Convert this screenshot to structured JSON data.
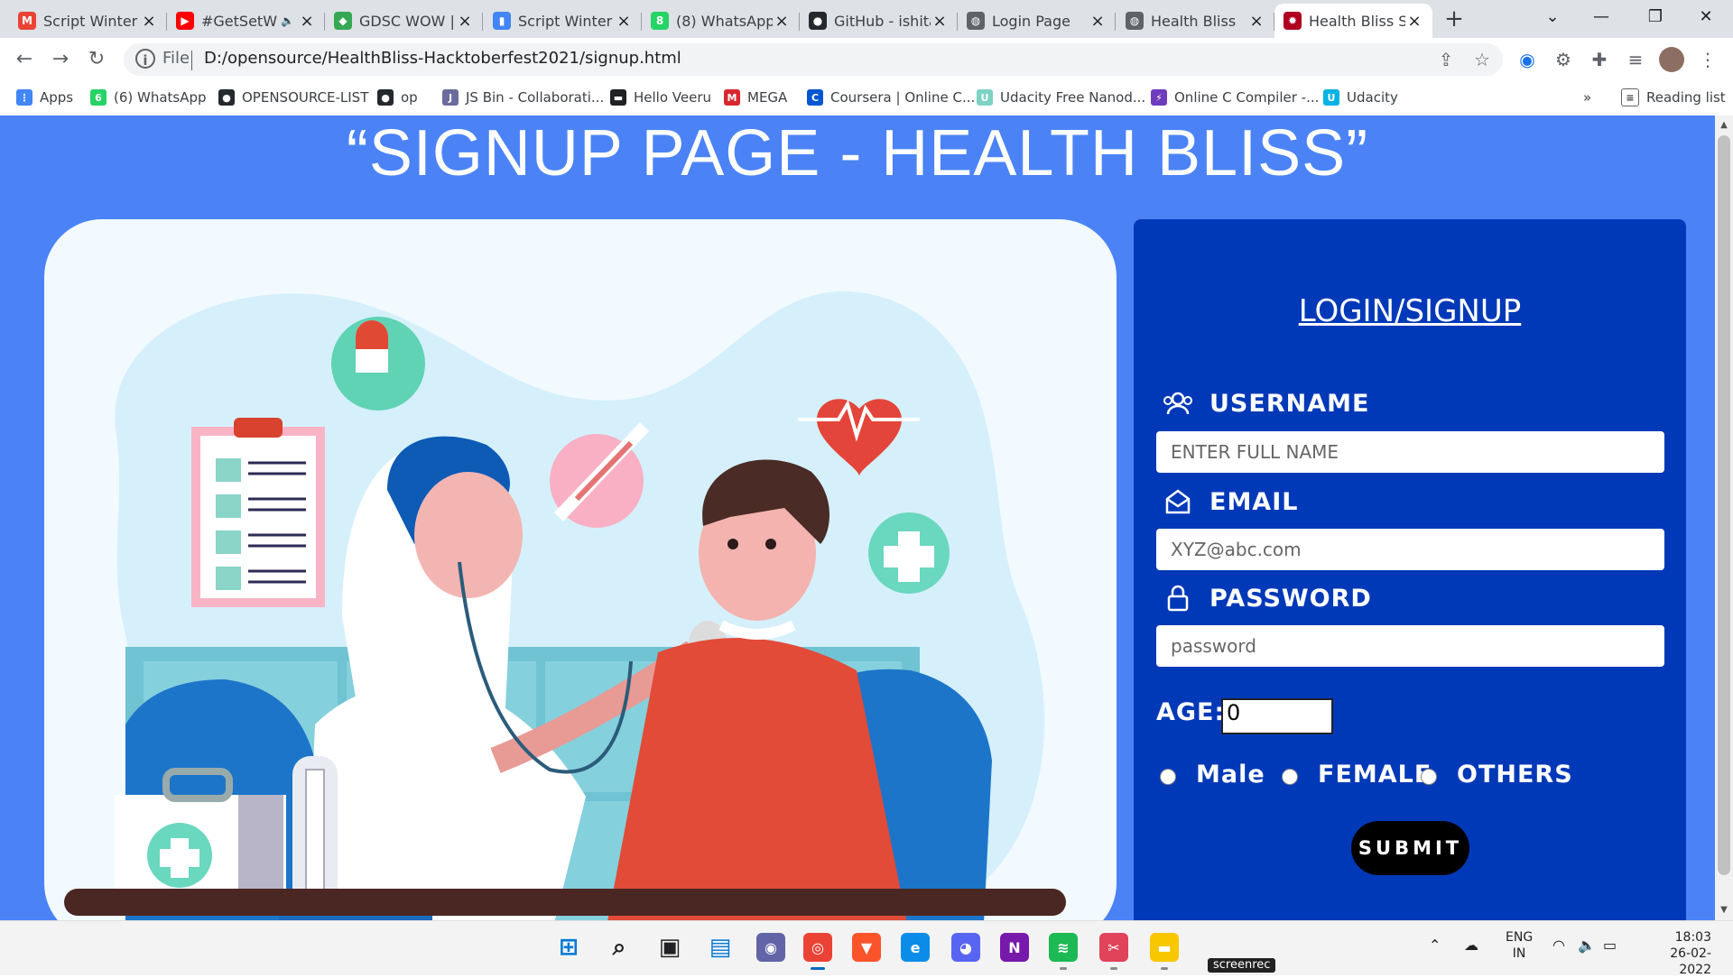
{
  "browser": {
    "tabs": [
      {
        "title": "Script Winter (",
        "favicon": "gmail-icon",
        "color": "#ea4335",
        "glyph": "M"
      },
      {
        "title": "#GetSetW",
        "favicon": "youtube-icon",
        "color": "#ff0000",
        "glyph": "▶",
        "muted": true
      },
      {
        "title": "GDSC WOW | ",
        "favicon": "gdsc-icon",
        "color": "#34a853",
        "glyph": "◆"
      },
      {
        "title": "Script Winter (",
        "favicon": "docs-icon",
        "color": "#4285f4",
        "glyph": "▮"
      },
      {
        "title": "(8) WhatsApp",
        "favicon": "whatsapp-icon",
        "color": "#25d366",
        "glyph": "8"
      },
      {
        "title": "GitHub - ishita",
        "favicon": "github-icon",
        "color": "#24292e",
        "glyph": "●"
      },
      {
        "title": "Login Page",
        "favicon": "globe-icon",
        "color": "#5f6368",
        "glyph": "◍"
      },
      {
        "title": "Health Bliss",
        "favicon": "globe-icon",
        "color": "#5f6368",
        "glyph": "◍"
      },
      {
        "title": "Health Bliss Si",
        "favicon": "virus-icon",
        "color": "#b00020",
        "glyph": "✹",
        "active": true
      }
    ],
    "new_tab": "+",
    "address": {
      "scheme": "File",
      "url": "D:/opensource/HealthBliss-Hacktoberfest2021/signup.html"
    },
    "bookmarks": [
      {
        "label": "Apps",
        "icon": "apps-icon",
        "color": "#4285f4",
        "glyph": "⋮"
      },
      {
        "label": "(6) WhatsApp",
        "icon": "whatsapp-icon",
        "color": "#25d366",
        "glyph": "6"
      },
      {
        "label": "OPENSOURCE-LIST",
        "icon": "github-icon",
        "color": "#24292e",
        "glyph": "●"
      },
      {
        "label": "op",
        "icon": "github-icon",
        "color": "#24292e",
        "glyph": "●"
      },
      {
        "label": "JS Bin - Collaborati...",
        "icon": "jsbin-icon",
        "color": "#6b6b9e",
        "glyph": "J"
      },
      {
        "label": "Hello Veeru",
        "icon": "bookmark-icon",
        "color": "#202124",
        "glyph": "▬"
      },
      {
        "label": "MEGA",
        "icon": "mega-icon",
        "color": "#d9272e",
        "glyph": "M"
      },
      {
        "label": "Coursera | Online C...",
        "icon": "coursera-icon",
        "color": "#0056d2",
        "glyph": "C"
      },
      {
        "label": "Udacity Free Nanod...",
        "icon": "udacity-icon",
        "color": "#7dd3c4",
        "glyph": "U"
      },
      {
        "label": "Online C Compiler -...",
        "icon": "compiler-icon",
        "color": "#6e3cbc",
        "glyph": "⚡"
      },
      {
        "label": "Udacity",
        "icon": "udacity-icon",
        "color": "#02b3e4",
        "glyph": "U"
      }
    ],
    "more": "»",
    "reading_list": "Reading list"
  },
  "page": {
    "title": "“SIGNUP PAGE - HEALTH BLISS”",
    "form": {
      "heading": "LOGIN/SIGNUP",
      "username_label": "USERNAME",
      "username_placeholder": "ENTER FULL NAME",
      "email_label": "EMAIL",
      "email_placeholder": "XYZ@abc.com",
      "password_label": "PASSWORD",
      "password_placeholder": "password",
      "age_label": "AGE:",
      "age_value": "0",
      "gender_options": [
        "Male",
        "FEMALE",
        "OTHERS"
      ],
      "submit_label": "SUBMIT"
    },
    "colors": {
      "background": "#4b83f7",
      "form_panel": "#0039b8",
      "submit": "#000000"
    }
  },
  "taskbar": {
    "apps": [
      {
        "name": "start-icon",
        "color": "#0078d4",
        "glyph": "⊞"
      },
      {
        "name": "search-icon",
        "color": "#202124",
        "glyph": "⌕"
      },
      {
        "name": "task-view-icon",
        "color": "#202124",
        "glyph": "▣"
      },
      {
        "name": "widgets-icon",
        "color": "#0078d4",
        "glyph": "▤"
      },
      {
        "name": "teams-chat-icon",
        "color": "#6264a7",
        "glyph": "◉"
      },
      {
        "name": "chrome-icon",
        "color": "#ea4335",
        "glyph": "◎"
      },
      {
        "name": "brave-icon",
        "color": "#fb542b",
        "glyph": "▼"
      },
      {
        "name": "edge-icon",
        "color": "#0c8ce9",
        "glyph": "e"
      },
      {
        "name": "discord-icon",
        "color": "#5865f2",
        "glyph": "◕"
      },
      {
        "name": "onenote-icon",
        "color": "#7719aa",
        "glyph": "N"
      },
      {
        "name": "spotify-icon",
        "color": "#1db954",
        "glyph": "≋"
      },
      {
        "name": "snipping-icon",
        "color": "#e0445a",
        "glyph": "✂"
      },
      {
        "name": "file-explorer-icon",
        "color": "#f8c700",
        "glyph": "▬"
      }
    ],
    "screenrec": "screenrec",
    "lang_top": "ENG",
    "lang_bottom": "IN",
    "time": "18:03",
    "date": "26-02-2022"
  }
}
